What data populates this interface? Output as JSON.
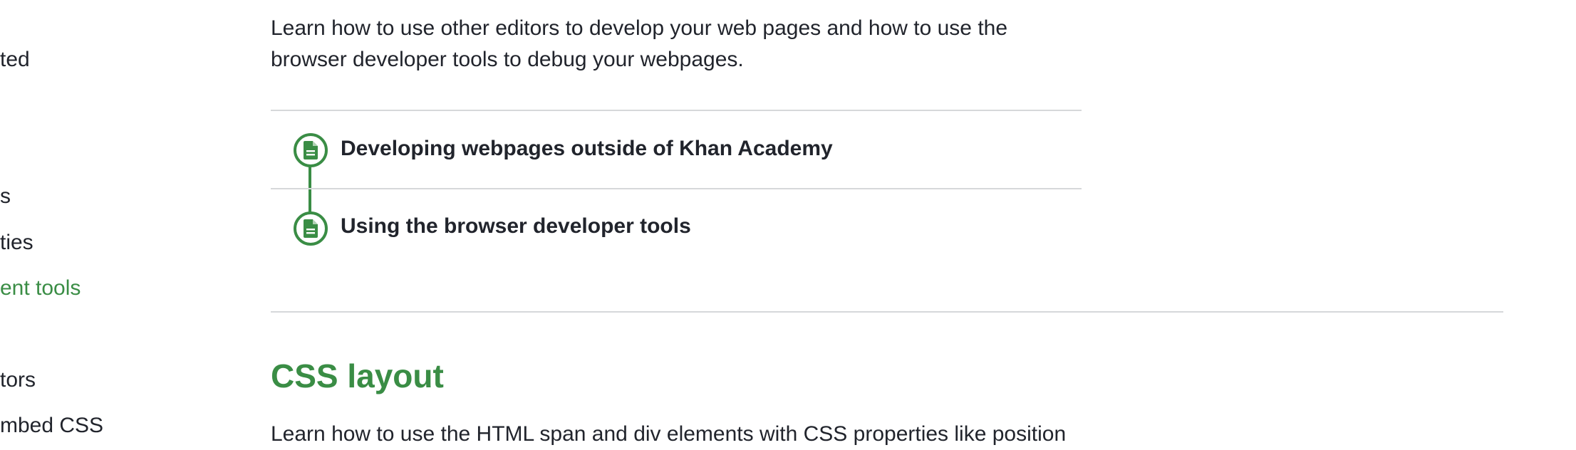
{
  "sidebar": {
    "items": [
      {
        "label": "ted",
        "active": false
      },
      {
        "label": "s",
        "active": false
      },
      {
        "label": "ties",
        "active": false
      },
      {
        "label": "ent tools",
        "active": true
      },
      {
        "label": "tors",
        "active": false
      },
      {
        "label": "mbed CSS",
        "active": false
      }
    ]
  },
  "main": {
    "intro": "Learn how to use other editors to develop your web pages and how to use the browser developer tools to debug your webpages.",
    "lessons": [
      {
        "title": "Developing webpages outside of Khan Academy",
        "icon": "article-icon"
      },
      {
        "title": "Using the browser developer tools",
        "icon": "article-icon"
      }
    ],
    "next_section": {
      "title": "CSS layout",
      "description": "Learn how to use the HTML span and div elements with CSS properties like position"
    }
  },
  "colors": {
    "accent": "#3a8d45",
    "text": "#21242c",
    "divider": "#d6d8da"
  }
}
